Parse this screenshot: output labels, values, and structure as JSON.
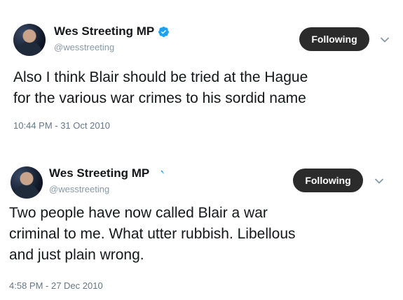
{
  "tweets": [
    {
      "display_name": "Wes Streeting MP",
      "handle": "@wesstreeting",
      "follow_label": "Following",
      "text": "Also I think Blair should be tried at the Hague\nfor the various war crimes to his sordid name",
      "timestamp": "10:44 PM - 31 Oct 2010",
      "verified_color": "#1da1f2"
    },
    {
      "display_name": "Wes Streeting MP",
      "handle": "@wesstreeting",
      "follow_label": "Following",
      "text": "Two people have now called Blair a war\ncriminal to me. What utter rubbish. Libellous\nand just plain wrong.",
      "timestamp": "4:58 PM - 27 Dec 2010",
      "verified_color": "#1da1f2"
    }
  ],
  "icons": {
    "verified": "verified-badge-icon",
    "chevron": "chevron-down-icon",
    "avatar": "profile-photo"
  }
}
